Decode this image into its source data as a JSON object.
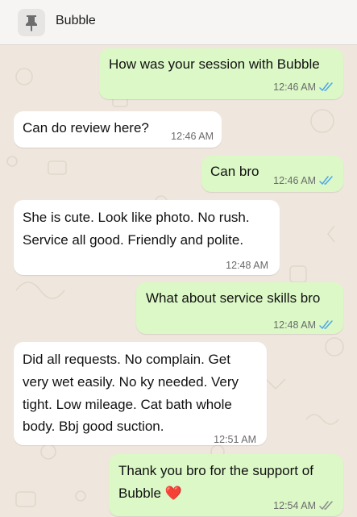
{
  "pinned": {
    "title": "Bubble",
    "icon": "pin-icon"
  },
  "colors": {
    "outgoing_bubble": "#dbf8c6",
    "incoming_bubble": "#ffffff",
    "read_ticks": "#4fa6e8",
    "wallpaper": "#efe7dd"
  },
  "messages": [
    {
      "direction": "out",
      "text": "How was your session with Bubble",
      "time": "12:46 AM",
      "status": "read"
    },
    {
      "direction": "in",
      "text": "Can do review here?",
      "time": "12:46 AM"
    },
    {
      "direction": "out",
      "text": "Can bro",
      "time": "12:46 AM",
      "status": "read"
    },
    {
      "direction": "in",
      "lines": [
        "She is cute. Look like photo. No rush.",
        "Service all good. Friendly and polite."
      ],
      "time": "12:48 AM"
    },
    {
      "direction": "out",
      "text": "What about service skills bro",
      "time": "12:48 AM",
      "status": "read"
    },
    {
      "direction": "in",
      "lines": [
        "Did all requests. No complain. Get",
        "very wet easily. No ky needed. Very",
        "tight. Low mileage. Cat bath whole",
        "body. Bbj good suction."
      ],
      "time": "12:51 AM"
    },
    {
      "direction": "out",
      "lines": [
        "Thank you bro for the support of",
        "Bubble ❤️"
      ],
      "time": "12:54 AM",
      "status": "delivered"
    }
  ]
}
